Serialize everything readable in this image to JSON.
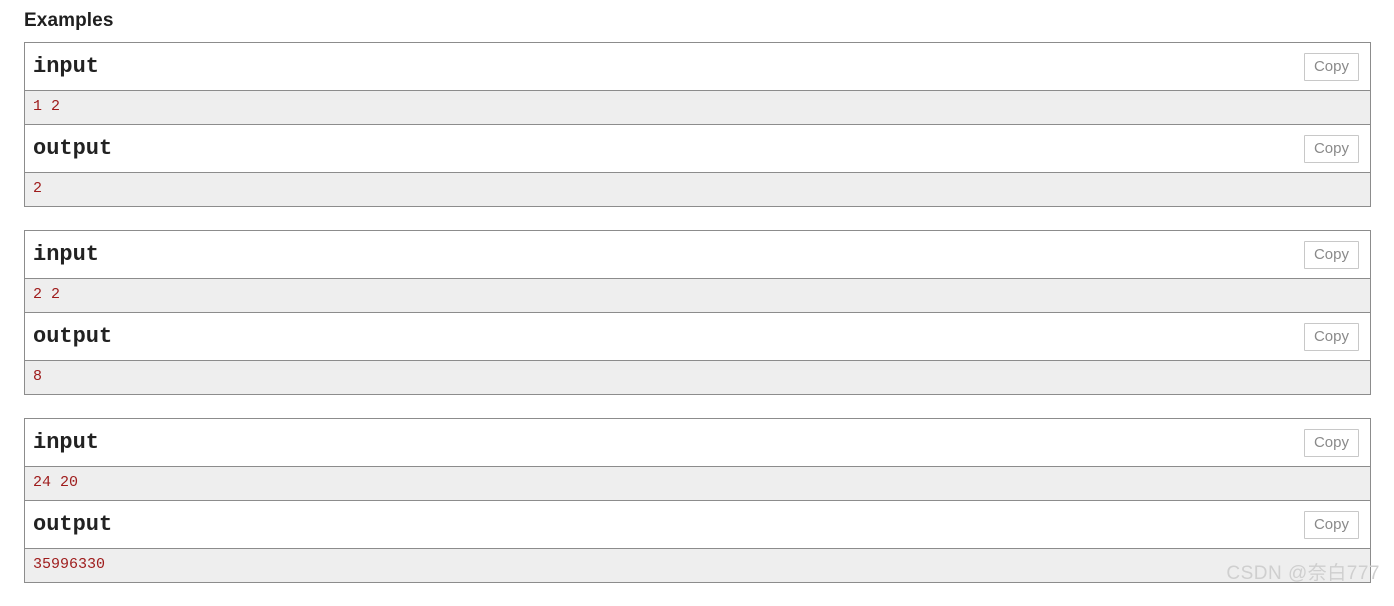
{
  "page": {
    "section_title": "Examples",
    "watermark": "CSDN @奈白777",
    "colors": {
      "data_text": "#9e1b1b",
      "data_background": "#eeeeee",
      "border": "#8c8c8c",
      "copy_border": "#c8c8c8",
      "copy_text": "#8a8a8a",
      "title_text": "#222222",
      "watermark_text": "#cfcfcf"
    }
  },
  "examples": [
    {
      "input": {
        "title": "input",
        "copy_label": "Copy",
        "value": "1 2"
      },
      "output": {
        "title": "output",
        "copy_label": "Copy",
        "value": "2"
      }
    },
    {
      "input": {
        "title": "input",
        "copy_label": "Copy",
        "value": "2 2"
      },
      "output": {
        "title": "output",
        "copy_label": "Copy",
        "value": "8"
      }
    },
    {
      "input": {
        "title": "input",
        "copy_label": "Copy",
        "value": "24 20"
      },
      "output": {
        "title": "output",
        "copy_label": "Copy",
        "value": "35996330"
      }
    }
  ]
}
